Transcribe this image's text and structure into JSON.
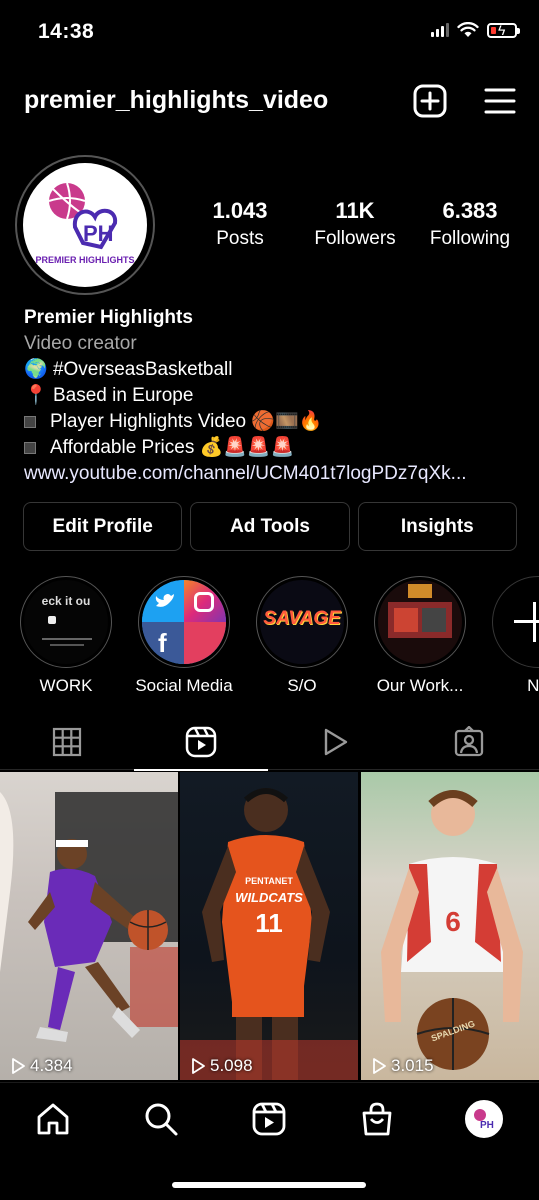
{
  "status_bar": {
    "time": "14:38"
  },
  "header": {
    "username": "premier_highlights_video"
  },
  "profile": {
    "avatar_text": "PREMIER HIGHLIGHTS",
    "stats": [
      {
        "value": "1.043",
        "label": "Posts"
      },
      {
        "value": "11K",
        "label": "Followers"
      },
      {
        "value": "6.383",
        "label": "Following"
      }
    ],
    "bio": {
      "name": "Premier Highlights",
      "category": "Video creator",
      "lines": [
        {
          "icon": "🌍",
          "text": "#OverseasBasketball"
        },
        {
          "icon": "📍",
          "text": "Based in Europe"
        },
        {
          "icon": "",
          "text": "Player Highlights Video 🏀🎞️🔥"
        },
        {
          "icon": "",
          "text": "Affordable Prices 💰🚨🚨🚨"
        }
      ],
      "link": "www.youtube.com/channel/UCM401t7logPDz7qXk..."
    }
  },
  "actions": {
    "edit_profile": "Edit Profile",
    "ad_tools": "Ad Tools",
    "insights": "Insights"
  },
  "highlights": [
    {
      "label": "WORK",
      "cover_text": "eck it ou"
    },
    {
      "label": "Social Media"
    },
    {
      "label": "S/O",
      "cover_text": "SAVAGE"
    },
    {
      "label": "Our Work..."
    },
    {
      "label": "Ne"
    }
  ],
  "tabs": [
    "grid-icon",
    "reels-icon",
    "play-icon",
    "tagged-icon"
  ],
  "reels": [
    {
      "views": "4.384",
      "jersey": ""
    },
    {
      "views": "5.098",
      "jersey": "11",
      "team": "WILDCATS",
      "sponsor": "PENTANET"
    },
    {
      "views": "3.015",
      "jersey": "6",
      "ball": "SPALDING"
    }
  ],
  "colors": {
    "background": "#000000",
    "border": "#363636",
    "secondary_text": "#a8a8a8"
  }
}
